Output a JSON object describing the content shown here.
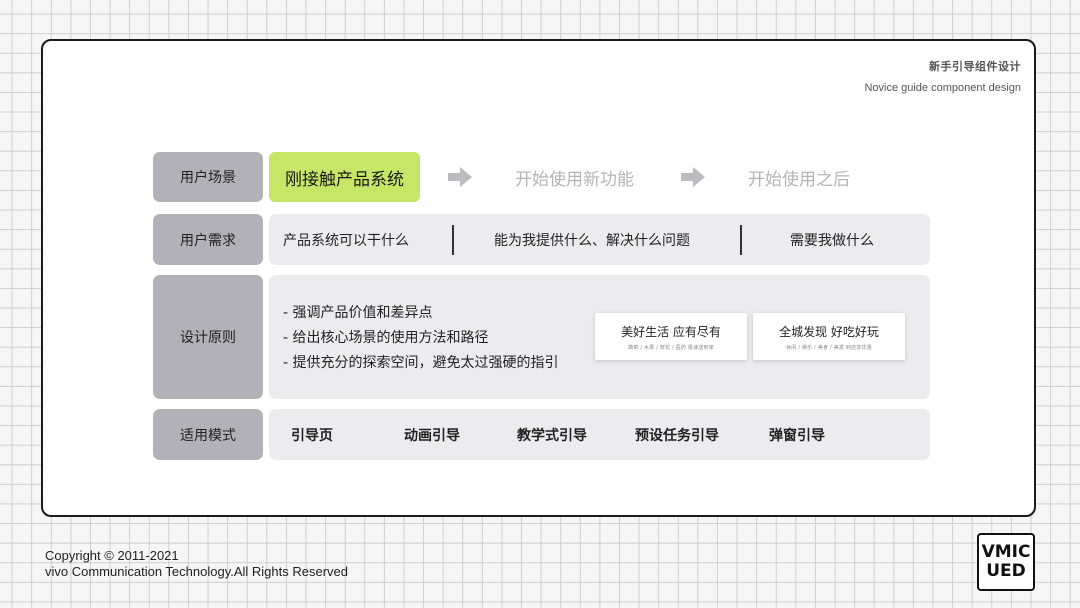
{
  "header": {
    "title_cn": "新手引导组件设计",
    "title_en": "Novice guide component design"
  },
  "rows": {
    "scene": {
      "label": "用户场景",
      "stages": [
        "刚接触产品系统",
        "开始使用新功能",
        "开始使用之后"
      ],
      "active_color": "#c5e667"
    },
    "needs": {
      "label": "用户需求",
      "items": [
        "产品系统可以干什么",
        "能为我提供什么、解决什么问题",
        "需要我做什么"
      ]
    },
    "principles": {
      "label": "设计原则",
      "items": [
        "- 强调产品价值和差异点",
        "- 给出核心场景的使用方法和路径",
        "- 提供充分的探索空间，避免太过强硬的指引"
      ],
      "examples": [
        {
          "title": "美好生活 应有尽有",
          "sub": "蔬菜 / 水果 / 鲜花 / 医药 极速送到家"
        },
        {
          "title": "全城发现 好吃好玩",
          "sub": "休闲 / 娱乐 / 美食 / 美发 到店享优惠"
        }
      ]
    },
    "modes": {
      "label": "适用模式",
      "items": [
        "引导页",
        "动画引导",
        "教学式引导",
        "预设任务引导",
        "弹窗引导"
      ]
    }
  },
  "footer": {
    "copyright_line1": "Copyright © 2011-2021",
    "copyright_line2": "vivo Communication Technology.All Rights Reserved",
    "logo_line1": "VMIC",
    "logo_line2": "UED"
  }
}
